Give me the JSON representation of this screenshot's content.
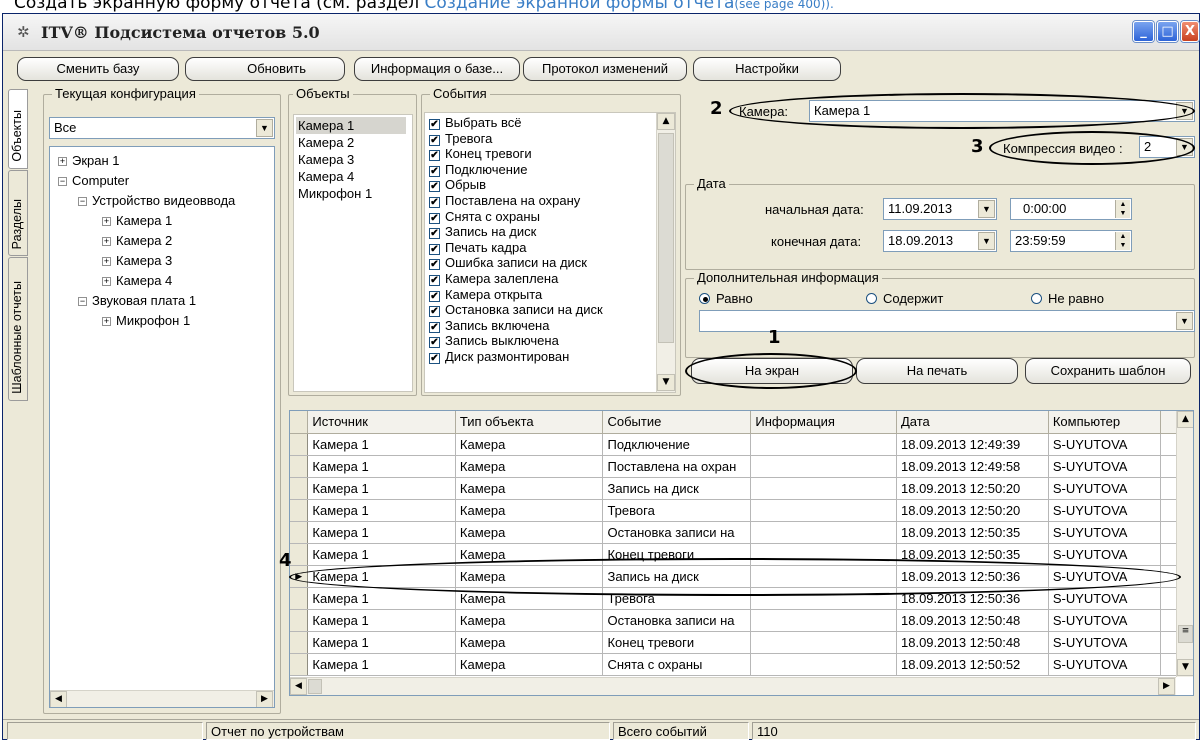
{
  "caption": {
    "text": "Создать экранную форму отчета (см. раздел",
    "link": "Создание экранной формы отчета",
    "page_ref": "(see page 400))."
  },
  "window": {
    "title": "ITV® Подсистема отчетов 5.0",
    "controls": {
      "minimize": "_",
      "maximize": "□",
      "close": "X"
    }
  },
  "toolbar": {
    "change_base": "Сменить базу",
    "refresh": "Обновить",
    "base_info": "Информация о базе...",
    "change_log": "Протокол изменений",
    "settings": "Настройки"
  },
  "tabs": [
    "Объекты",
    "Разделы",
    "Шаблонные отчеты"
  ],
  "config": {
    "label": "Текущая конфигурация",
    "selected": "Все",
    "tree": [
      {
        "label": "Экран 1",
        "sign": "+"
      },
      {
        "label": "Computer",
        "sign": "−"
      },
      {
        "label": "Устройство видеоввода",
        "sign": "−"
      },
      {
        "label": "Камера 1",
        "sign": "+"
      },
      {
        "label": "Камера 2",
        "sign": "+"
      },
      {
        "label": "Камера 3",
        "sign": "+"
      },
      {
        "label": "Камера 4",
        "sign": "+"
      },
      {
        "label": "Звуковая плата 1",
        "sign": "−"
      },
      {
        "label": "Микрофон 1",
        "sign": "+"
      }
    ]
  },
  "objects": {
    "label": "Объекты",
    "items": [
      "Камера 1",
      "Камера 2",
      "Камера 3",
      "Камера 4",
      "Микрофон 1"
    ]
  },
  "events": {
    "label": "События",
    "items": [
      "Выбрать всё",
      "Тревога",
      "Конец тревоги",
      "Подключение",
      "Обрыв",
      "Поставлена на охрану",
      "Снята с охраны",
      "Запись на диск",
      "Печать кадра",
      "Ошибка записи на диск",
      "Камера залеплена",
      "Камера открыта",
      "Остановка записи на диск",
      "Запись включена",
      "Запись выключена",
      "Диск размонтирован"
    ]
  },
  "filters": {
    "camera_label": "Камера:",
    "camera_value": "Камера 1",
    "compression_label": "Компрессия видео :",
    "compression_value": "2",
    "date_group": "Дата",
    "start_label": "начальная дата:",
    "start_date": "11.09.2013",
    "start_time": "0:00:00",
    "end_label": "конечная дата:",
    "end_date": "18.09.2013",
    "end_time": "23:59:59",
    "extra_group": "Дополнительная информация",
    "radio_equal": "Равно",
    "radio_contains": "Содержит",
    "radio_not_equal": "Не равно",
    "extra_value": ""
  },
  "actions": {
    "to_screen": "На экран",
    "to_print": "На печать",
    "save_template": "Сохранить шаблон"
  },
  "annotations": [
    "1",
    "2",
    "3",
    "4"
  ],
  "grid": {
    "columns": [
      "Источник",
      "Тип объекта",
      "Событие",
      "Информация",
      "Дата",
      "Компьютер"
    ],
    "rows": [
      [
        "Камера 1",
        "Камера",
        "Подключение",
        "",
        "18.09.2013 12:49:39",
        "S-UYUTOVA"
      ],
      [
        "Камера 1",
        "Камера",
        "Поставлена на охран",
        "",
        "18.09.2013 12:49:58",
        "S-UYUTOVA"
      ],
      [
        "Камера 1",
        "Камера",
        "Запись на диск",
        "",
        "18.09.2013 12:50:20",
        "S-UYUTOVA"
      ],
      [
        "Камера 1",
        "Камера",
        "Тревога",
        "",
        "18.09.2013 12:50:20",
        "S-UYUTOVA"
      ],
      [
        "Камера 1",
        "Камера",
        "Остановка записи на",
        "",
        "18.09.2013 12:50:35",
        "S-UYUTOVA"
      ],
      [
        "Камера 1",
        "Камера",
        "Конец тревоги",
        "",
        "18.09.2013 12:50:35",
        "S-UYUTOVA"
      ],
      [
        "Камера 1",
        "Камера",
        "Запись на диск",
        "",
        "18.09.2013 12:50:36",
        "S-UYUTOVA"
      ],
      [
        "Камера 1",
        "Камера",
        "Тревога",
        "",
        "18.09.2013 12:50:36",
        "S-UYUTOVA"
      ],
      [
        "Камера 1",
        "Камера",
        "Остановка записи на",
        "",
        "18.09.2013 12:50:48",
        "S-UYUTOVA"
      ],
      [
        "Камера 1",
        "Камера",
        "Конец тревоги",
        "",
        "18.09.2013 12:50:48",
        "S-UYUTOVA"
      ],
      [
        "Камера 1",
        "Камера",
        "Снята с охраны",
        "",
        "18.09.2013 12:50:52",
        "S-UYUTOVA"
      ]
    ],
    "selected_row": 6
  },
  "status": {
    "report_type": "Отчет по устройствам",
    "total_label": "Всего событий",
    "total_value": "110"
  },
  "icons": {
    "app": "gear-icon",
    "checkmark": "✔"
  }
}
